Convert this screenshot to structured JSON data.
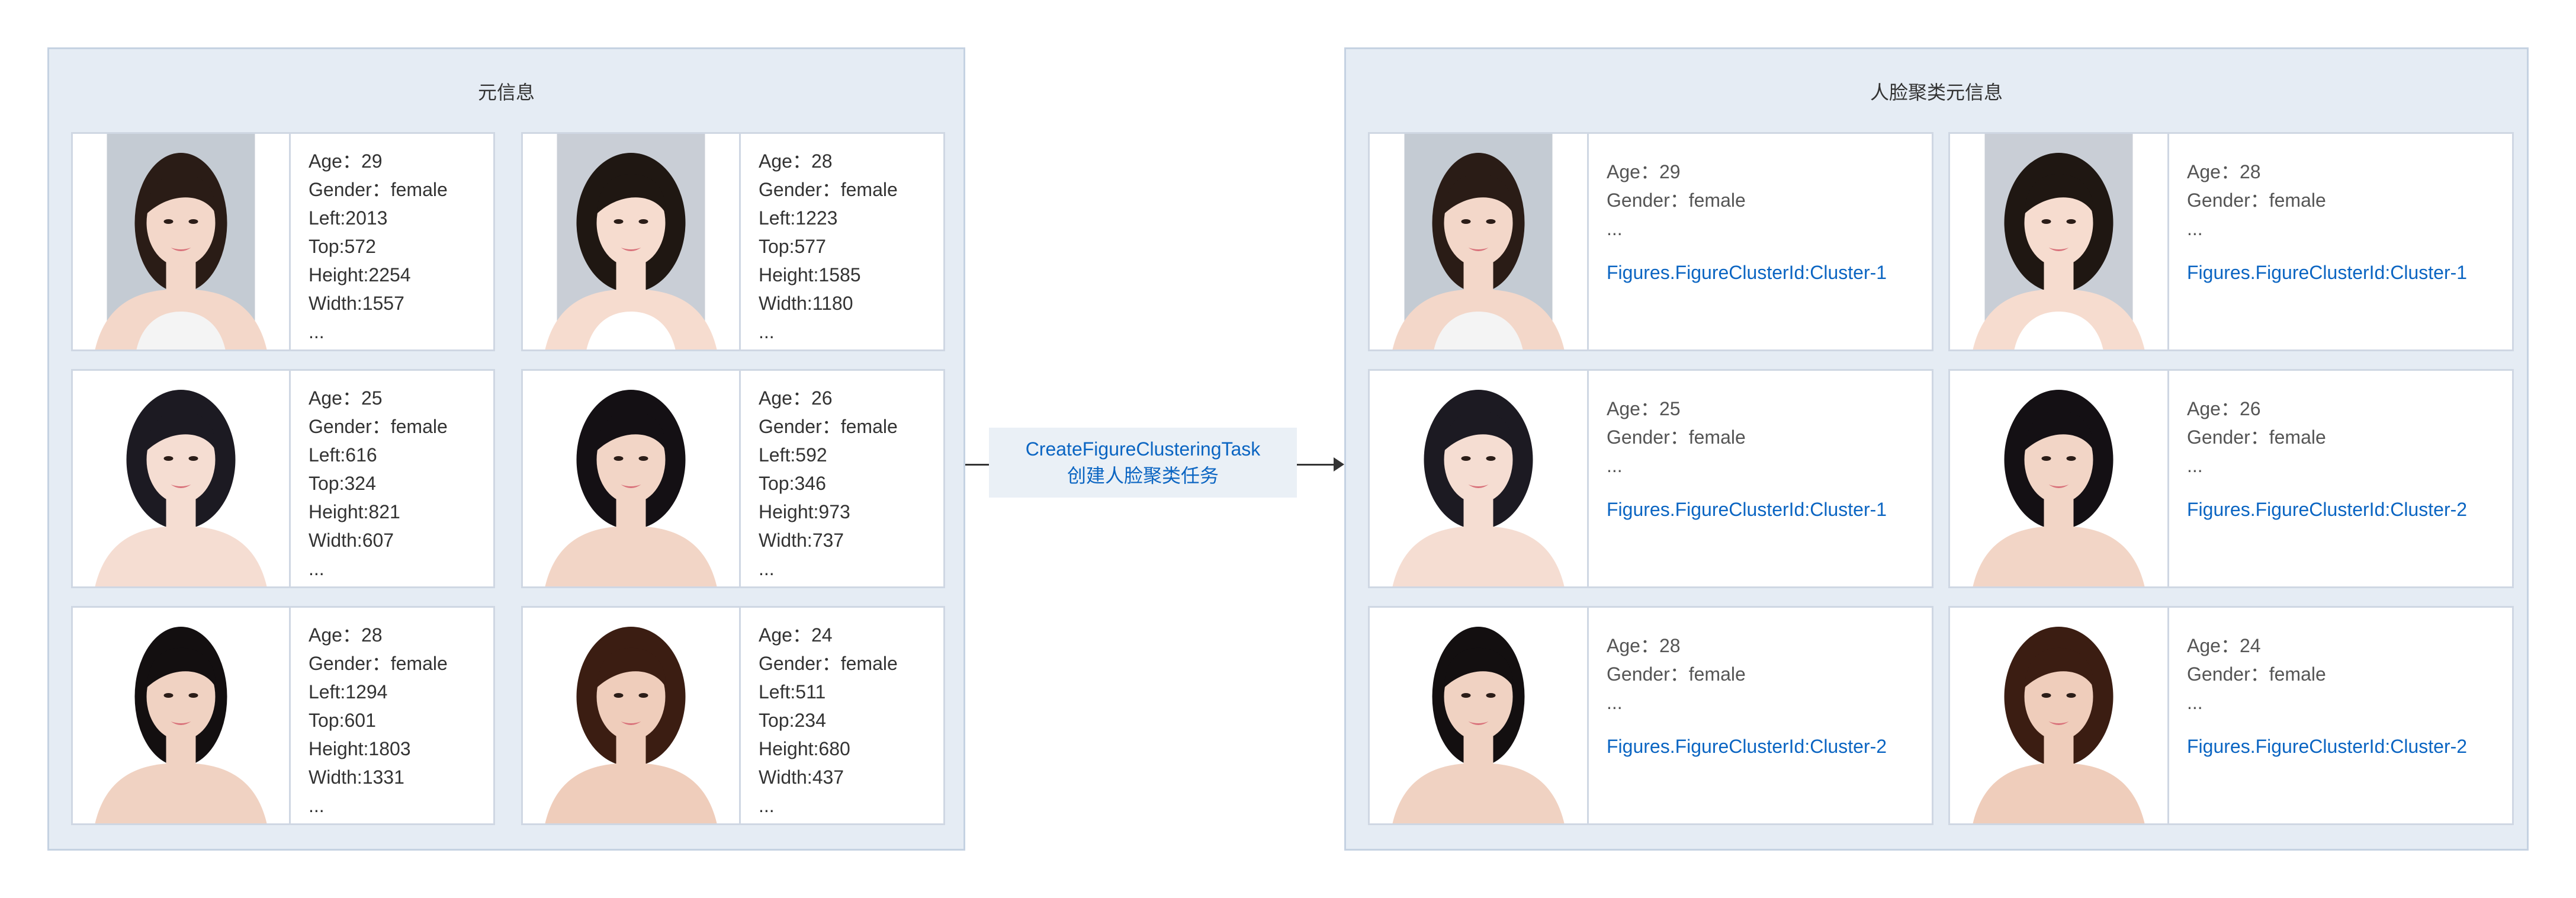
{
  "left_panel": {
    "title": "元信息",
    "cards": [
      {
        "lines": [
          "Age：29",
          "Gender：female",
          "Left:2013",
          "Top:572",
          "Height:2254",
          "Width:1557",
          "..."
        ]
      },
      {
        "lines": [
          "Age：28",
          "Gender：female",
          "Left:1223",
          "Top:577",
          "Height:1585",
          "Width:1180",
          "..."
        ]
      },
      {
        "lines": [
          "Age：25",
          "Gender：female",
          "Left:616",
          "Top:324",
          "Height:821",
          "Width:607",
          "..."
        ]
      },
      {
        "lines": [
          "Age：26",
          "Gender：female",
          "Left:592",
          "Top:346",
          "Height:973",
          "Width:737",
          "..."
        ]
      },
      {
        "lines": [
          "Age：28",
          "Gender：female",
          "Left:1294",
          "Top:601",
          "Height:1803",
          "Width:1331",
          "..."
        ]
      },
      {
        "lines": [
          "Age：24",
          "Gender：female",
          "Left:511",
          "Top:234",
          "Height:680",
          "Width:437",
          "..."
        ]
      }
    ]
  },
  "task": {
    "name": "CreateFigureClusteringTask",
    "label": "创建人脸聚类任务"
  },
  "right_panel": {
    "title": "人脸聚类元信息",
    "cards": [
      {
        "lines": [
          "Age：29",
          "Gender：female",
          "..."
        ],
        "cluster": "Figures.FigureClusterId:Cluster-1"
      },
      {
        "lines": [
          "Age：28",
          "Gender：female",
          "..."
        ],
        "cluster": "Figures.FigureClusterId:Cluster-1"
      },
      {
        "lines": [
          "Age：25",
          "Gender：female",
          "..."
        ],
        "cluster": "Figures.FigureClusterId:Cluster-1"
      },
      {
        "lines": [
          "Age：26",
          "Gender：female",
          "..."
        ],
        "cluster": "Figures.FigureClusterId:Cluster-2"
      },
      {
        "lines": [
          "Age：28",
          "Gender：female",
          "..."
        ],
        "cluster": "Figures.FigureClusterId:Cluster-2"
      },
      {
        "lines": [
          "Age：24",
          "Gender：female",
          "..."
        ],
        "cluster": "Figures.FigureClusterId:Cluster-2"
      }
    ]
  },
  "colors": {
    "panel_bg": "#e5ecf4",
    "panel_border": "#c5d2e2",
    "card_border": "#cfd7e3",
    "link_blue": "#0b65c2",
    "text": "#333333"
  }
}
